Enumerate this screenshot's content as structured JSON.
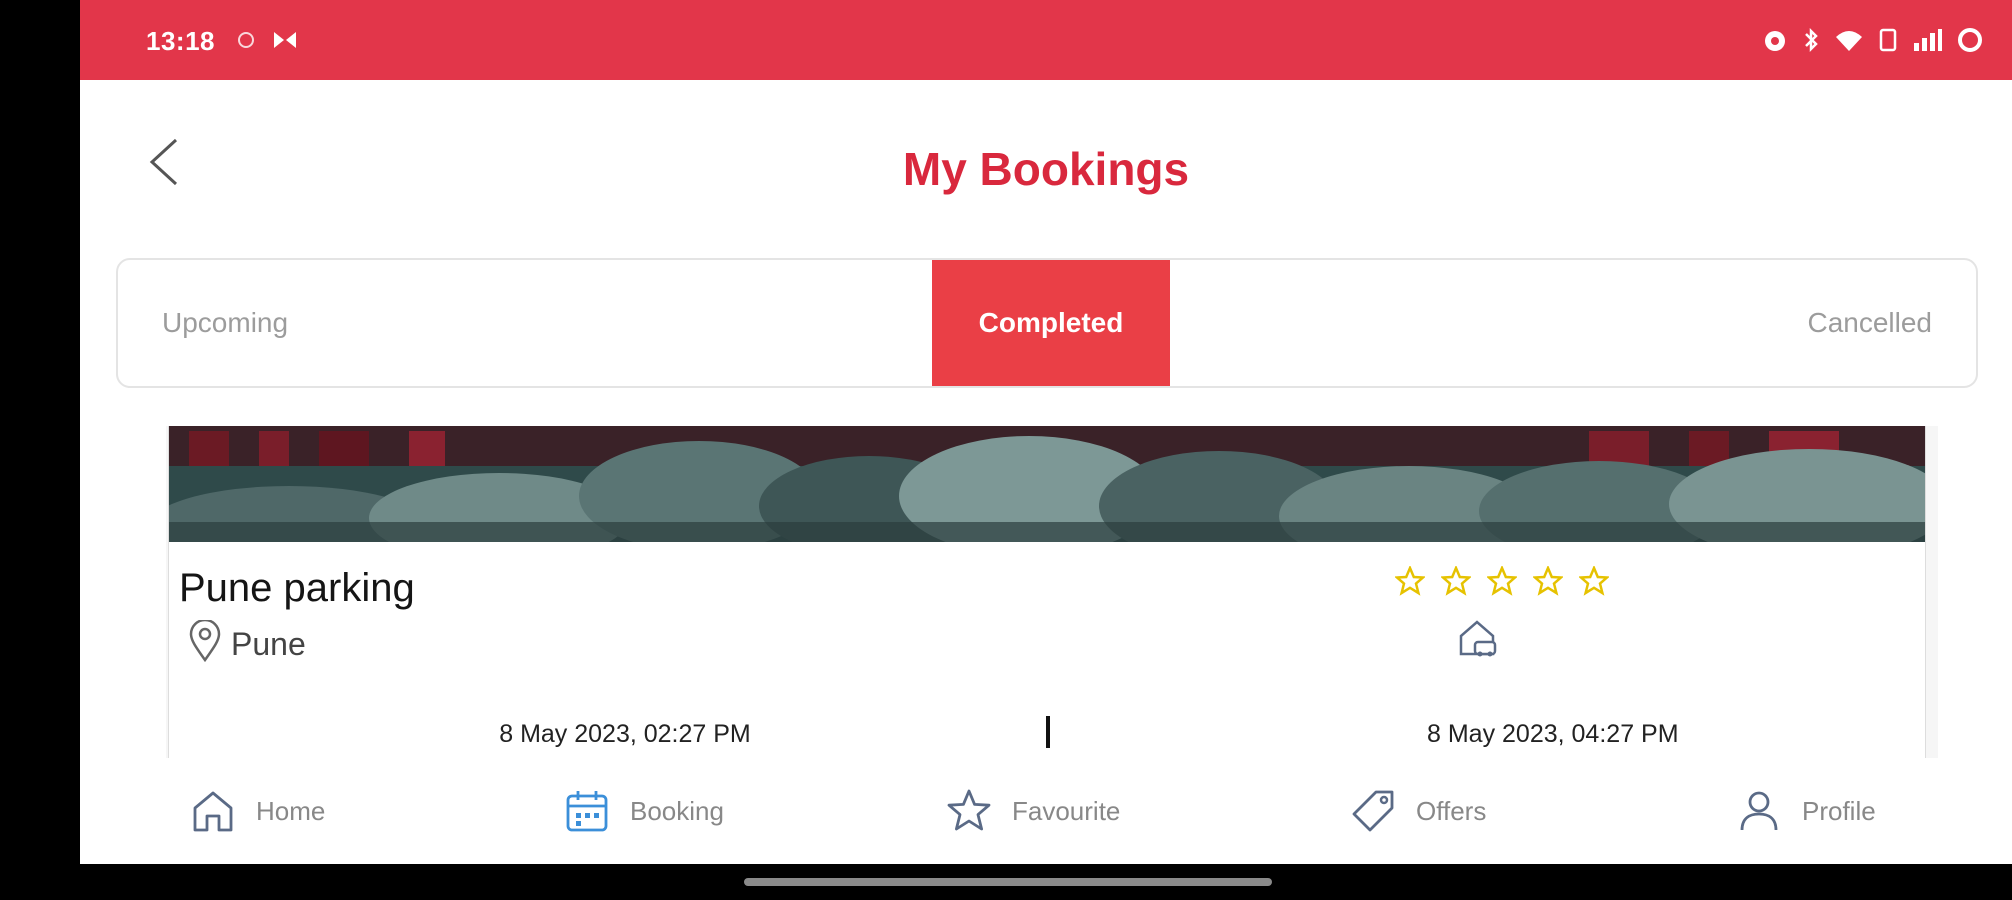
{
  "status_bar": {
    "time": "13:18",
    "icons": [
      "alarm-icon",
      "bluetooth-icon",
      "wifi-icon",
      "sim-icon",
      "signal-icon",
      "battery-icon"
    ]
  },
  "header": {
    "title": "My Bookings",
    "back_icon": "chevron-left-icon"
  },
  "tabs": [
    {
      "label": "Upcoming",
      "active": false
    },
    {
      "label": "Completed",
      "active": true
    },
    {
      "label": "Cancelled",
      "active": false
    }
  ],
  "booking": {
    "name": "Pune parking",
    "city": "Pune",
    "rating_stars": 5,
    "start": "8 May 2023, 02:27 PM",
    "end": "8 May 2023, 04:27 PM"
  },
  "nav": [
    {
      "label": "Home",
      "icon": "home-icon"
    },
    {
      "label": "Booking",
      "icon": "calendar-icon"
    },
    {
      "label": "Favourite",
      "icon": "star-icon"
    },
    {
      "label": "Offers",
      "icon": "tag-icon"
    },
    {
      "label": "Profile",
      "icon": "user-icon"
    }
  ],
  "colors": {
    "brand_red": "#e2364a",
    "active_tab": "#ea3f46",
    "star_yellow": "#e6c200",
    "nav_active_blue": "#3b8fd9"
  }
}
